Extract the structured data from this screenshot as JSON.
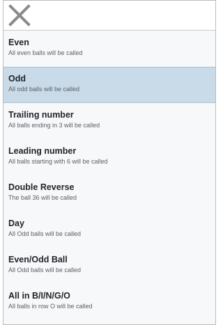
{
  "header": {
    "close_icon": "close-icon"
  },
  "menu": {
    "selected_index": 1,
    "items": [
      {
        "title": "Even",
        "description": "All even balls will be called"
      },
      {
        "title": "Odd",
        "description": "All odd balls will be called"
      },
      {
        "title": "Trailing number",
        "description": "All balls ending in 3 will be called"
      },
      {
        "title": "Leading number",
        "description": "All balls starting with 6 will be called"
      },
      {
        "title": "Double Reverse",
        "description": "The ball 36 will be called"
      },
      {
        "title": "Day",
        "description": "All Odd balls will be called"
      },
      {
        "title": "Even/Odd Ball",
        "description": "All Odd balls will be called"
      },
      {
        "title": "All in B/I/N/G/O",
        "description": "All balls in row O will be called"
      }
    ]
  },
  "colors": {
    "selected_background": "#c9dbe8",
    "icon": "#8a8a8a",
    "title_text": "#1f2328",
    "description_text": "#5a6068"
  }
}
